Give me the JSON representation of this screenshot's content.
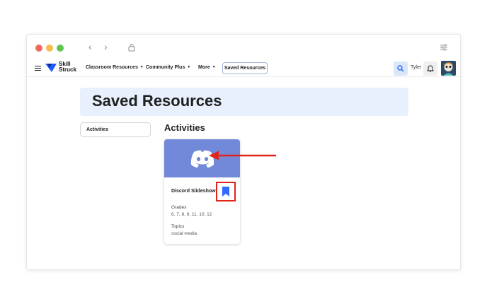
{
  "header": {
    "logo_line1": "Skill",
    "logo_line2": "Struck",
    "menu": [
      {
        "label": "Classroom Resources"
      },
      {
        "label": "Community Plus"
      },
      {
        "label": "More"
      }
    ],
    "saved_label": "Saved Resources",
    "username": "Tyler"
  },
  "page": {
    "title": "Saved Resources",
    "sidebar_item": "Activities",
    "section_title": "Activities"
  },
  "card": {
    "title": "Discord Slideshow",
    "grades_label": "Grades",
    "grades_value": "6, 7, 8, 9, 11, 10, 12",
    "topics_label": "Topics",
    "topics_value": "social media",
    "bookmarked": true
  },
  "colors": {
    "accent": "#2f6bff",
    "discord_banner": "#7289da",
    "highlight": "#e1251b",
    "hero_bg": "#e7f0fc"
  },
  "icons": [
    "lock-icon",
    "sliders-icon",
    "search-icon",
    "bell-icon",
    "discord-logo-icon",
    "bookmark-icon",
    "annotation-arrow-icon"
  ]
}
